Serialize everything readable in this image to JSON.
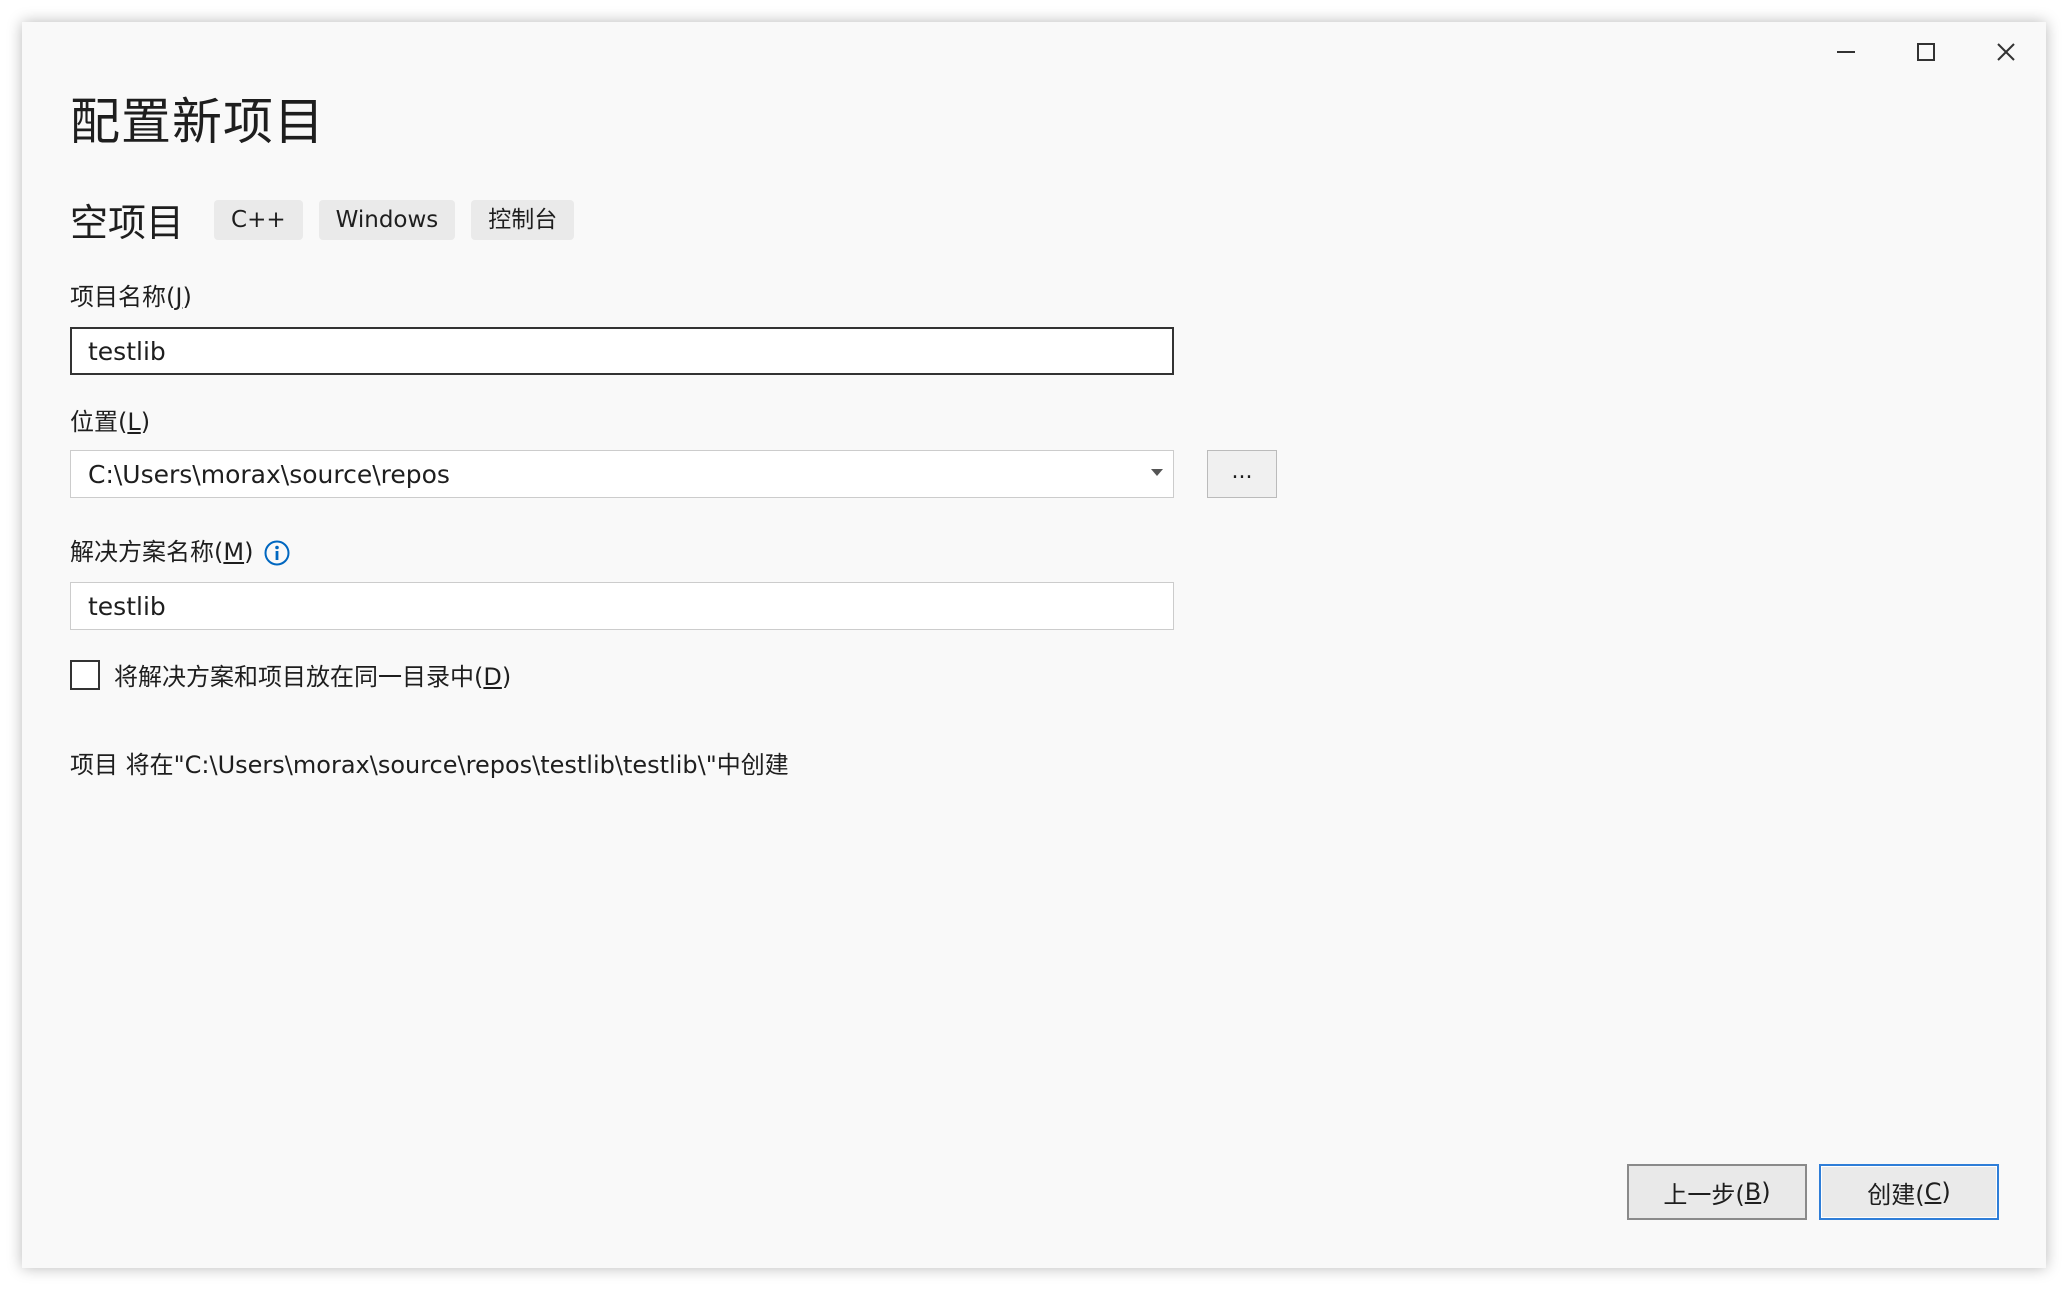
{
  "window": {
    "title": "配置新项目",
    "controls": {
      "minimize_icon": "minimize-icon",
      "maximize_icon": "maximize-icon",
      "close_icon": "close-icon"
    }
  },
  "template": {
    "name": "空项目",
    "tags": [
      "C++",
      "Windows",
      "控制台"
    ]
  },
  "project_name": {
    "label": "项目名称(",
    "accel": "J",
    "label_end": ")",
    "value": "testlib"
  },
  "location": {
    "label": "位置(",
    "accel": "L",
    "label_end": ")",
    "value": "C:\\Users\\morax\\source\\repos",
    "browse_label": "..."
  },
  "solution_name": {
    "label": "解决方案名称(",
    "accel": "M",
    "label_end": ")",
    "value": "testlib",
    "info_icon": "info-icon"
  },
  "same_dir": {
    "label": "将解决方案和项目放在同一目录中(",
    "accel": "D",
    "label_end": ")",
    "checked": false
  },
  "summary": "项目 将在\"C:\\Users\\morax\\source\\repos\\testlib\\testlib\\\"中创建",
  "footer": {
    "back": {
      "label": "上一步(",
      "accel": "B",
      "label_end": ")"
    },
    "create": {
      "label": "创建(",
      "accel": "C",
      "label_end": ")"
    }
  },
  "colors": {
    "accent": "#2f7ed8",
    "info": "#0067c0"
  }
}
